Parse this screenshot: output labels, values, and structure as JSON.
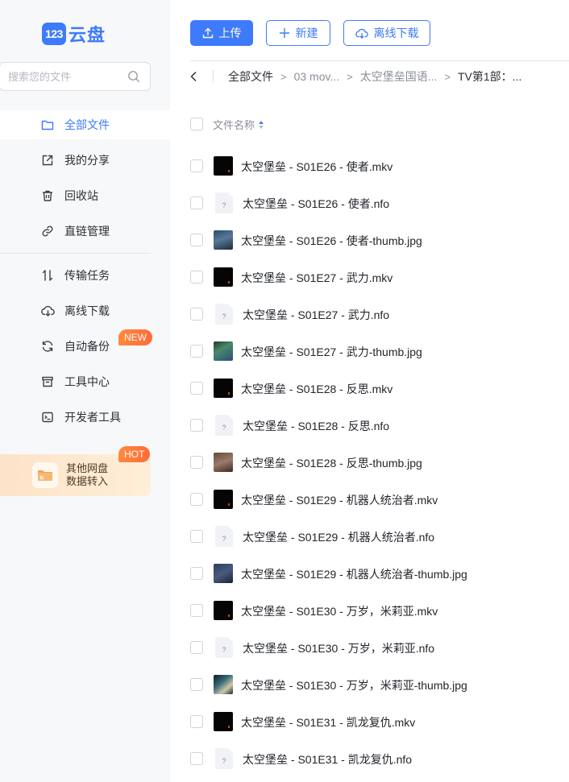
{
  "brand": {
    "mark": "123",
    "name": "云盘",
    "accent": "#3e7bfa"
  },
  "search": {
    "placeholder": "搜索您的文件",
    "icon": "search-icon"
  },
  "sidebar": {
    "items": [
      {
        "label": "全部文件",
        "icon": "folder-icon",
        "active": true
      },
      {
        "label": "我的分享",
        "icon": "share-icon"
      },
      {
        "label": "回收站",
        "icon": "trash-icon"
      },
      {
        "label": "直链管理",
        "icon": "link-icon"
      },
      {
        "label": "传输任务",
        "icon": "transfer-icon"
      },
      {
        "label": "离线下载",
        "icon": "cloud-download-icon"
      },
      {
        "label": "自动备份",
        "icon": "sync-icon",
        "badge": "NEW"
      },
      {
        "label": "工具中心",
        "icon": "toolbox-icon"
      },
      {
        "label": "开发者工具",
        "icon": "terminal-icon"
      }
    ],
    "promo": {
      "line1": "其他网盘",
      "line2": "数据转入",
      "badge": "HOT",
      "icon": "folder-import-icon"
    }
  },
  "toolbar": {
    "upload_label": "上传",
    "new_label": "新建",
    "offline_label": "离线下载"
  },
  "breadcrumb": {
    "items": [
      "全部文件",
      "03 mov...",
      "太空堡垒国语...",
      "TV第1部：..."
    ]
  },
  "table": {
    "header": "文件名称",
    "rows": [
      {
        "name": "太空堡垒 - S01E26 - 使者.mkv",
        "type": "video"
      },
      {
        "name": "太空堡垒 - S01E26 - 使者.nfo",
        "type": "nfo"
      },
      {
        "name": "太空堡垒 - S01E26 - 使者-thumb.jpg",
        "type": "image"
      },
      {
        "name": "太空堡垒 - S01E27 - 武力.mkv",
        "type": "video"
      },
      {
        "name": "太空堡垒 - S01E27 - 武力.nfo",
        "type": "nfo"
      },
      {
        "name": "太空堡垒 - S01E27 - 武力-thumb.jpg",
        "type": "image"
      },
      {
        "name": "太空堡垒 - S01E28 - 反思.mkv",
        "type": "video"
      },
      {
        "name": "太空堡垒 - S01E28 - 反思.nfo",
        "type": "nfo"
      },
      {
        "name": "太空堡垒 - S01E28 - 反思-thumb.jpg",
        "type": "image"
      },
      {
        "name": "太空堡垒 - S01E29 - 机器人统治者.mkv",
        "type": "video"
      },
      {
        "name": "太空堡垒 - S01E29 - 机器人统治者.nfo",
        "type": "nfo"
      },
      {
        "name": "太空堡垒 - S01E29 - 机器人统治者-thumb.jpg",
        "type": "image"
      },
      {
        "name": "太空堡垒 - S01E30 - 万岁，米莉亚.mkv",
        "type": "video"
      },
      {
        "name": "太空堡垒 - S01E30 - 万岁，米莉亚.nfo",
        "type": "nfo"
      },
      {
        "name": "太空堡垒 - S01E30 - 万岁，米莉亚-thumb.jpg",
        "type": "image"
      },
      {
        "name": "太空堡垒 - S01E31 - 凯龙复仇.mkv",
        "type": "video"
      },
      {
        "name": "太空堡垒 - S01E31 - 凯龙复仇.nfo",
        "type": "nfo"
      }
    ],
    "nfo_glyph": "?"
  }
}
